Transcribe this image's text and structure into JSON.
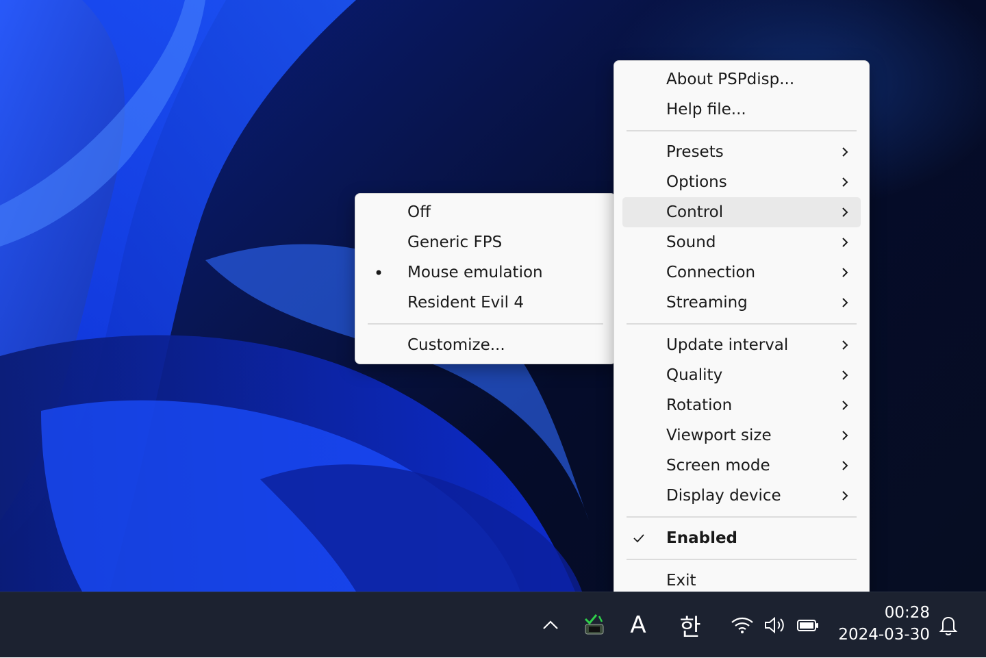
{
  "main_menu": {
    "items": [
      {
        "label": "About PSPdisp..."
      },
      {
        "label": "Help file..."
      },
      {
        "label": "Presets"
      },
      {
        "label": "Options"
      },
      {
        "label": "Control"
      },
      {
        "label": "Sound"
      },
      {
        "label": "Connection"
      },
      {
        "label": "Streaming"
      },
      {
        "label": "Update interval"
      },
      {
        "label": "Quality"
      },
      {
        "label": "Rotation"
      },
      {
        "label": "Viewport size"
      },
      {
        "label": "Screen mode"
      },
      {
        "label": "Display device"
      },
      {
        "label": "Enabled",
        "checked": true
      },
      {
        "label": "Exit"
      }
    ],
    "highlighted": "Control"
  },
  "control_submenu": {
    "items": [
      {
        "label": "Off"
      },
      {
        "label": "Generic FPS"
      },
      {
        "label": "Mouse emulation",
        "selected": true
      },
      {
        "label": "Resident Evil 4"
      },
      {
        "label": "Customize..."
      }
    ]
  },
  "taskbar": {
    "tray": {
      "chevron_icon": "chevron-up-icon",
      "app_icon": "pspdisp-tray-icon",
      "ime_mode": "A",
      "ime_language": "한",
      "wifi_icon": "wifi-icon",
      "volume_icon": "volume-icon",
      "battery_icon": "battery-icon",
      "notification_icon": "bell-icon"
    },
    "clock": {
      "time": "00:28",
      "date": "2024-03-30"
    }
  },
  "colors": {
    "menu_bg": "#f9f9f9",
    "menu_highlight": "#e9e9e9",
    "taskbar_bg": "#1c2230",
    "wallpaper_blue": "#1a4cff"
  }
}
